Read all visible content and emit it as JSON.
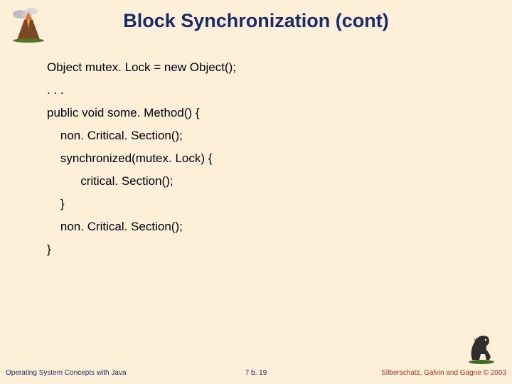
{
  "title": "Block Synchronization (cont)",
  "code": {
    "l0": "Object mutex. Lock = new Object();",
    "l1": ". . .",
    "l2": "public void some. Method() {",
    "l3": "    non. Critical. Section();",
    "l4": "    synchronized(mutex. Lock) {",
    "l5": "          critical. Section();",
    "l6": "    }",
    "l7": "    non. Critical. Section();",
    "l8": "}"
  },
  "footer": {
    "left": "Operating System Concepts with Java",
    "center": "7 b. 19",
    "right": "Silberschatz, Galvin and Gagne © 2003"
  }
}
